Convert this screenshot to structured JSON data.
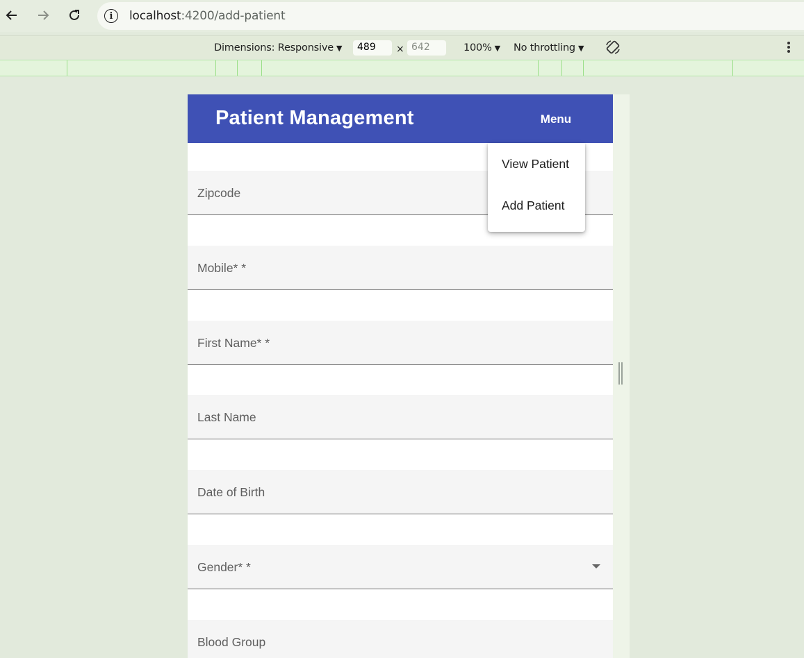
{
  "browser": {
    "url_host": "localhost",
    "url_rest": ":4200/add-patient"
  },
  "devtools": {
    "dimensions_label": "Dimensions: Responsive",
    "width_value": "489",
    "times": "×",
    "height_placeholder": "642",
    "zoom": "100%",
    "throttling": "No throttling"
  },
  "app": {
    "title": "Patient Management",
    "menu_label": "Menu",
    "primary_color": "#3f51b5"
  },
  "menu": {
    "items": [
      {
        "label": "View Patient"
      },
      {
        "label": "Add Patient"
      }
    ]
  },
  "form": {
    "fields": [
      {
        "label": "Zipcode",
        "type": "text"
      },
      {
        "label": "Mobile* *",
        "type": "text"
      },
      {
        "label": "First Name* *",
        "type": "text"
      },
      {
        "label": "Last Name",
        "type": "text"
      },
      {
        "label": "Date of Birth",
        "type": "text"
      },
      {
        "label": "Gender* *",
        "type": "select"
      },
      {
        "label": "Blood Group",
        "type": "text"
      }
    ]
  }
}
